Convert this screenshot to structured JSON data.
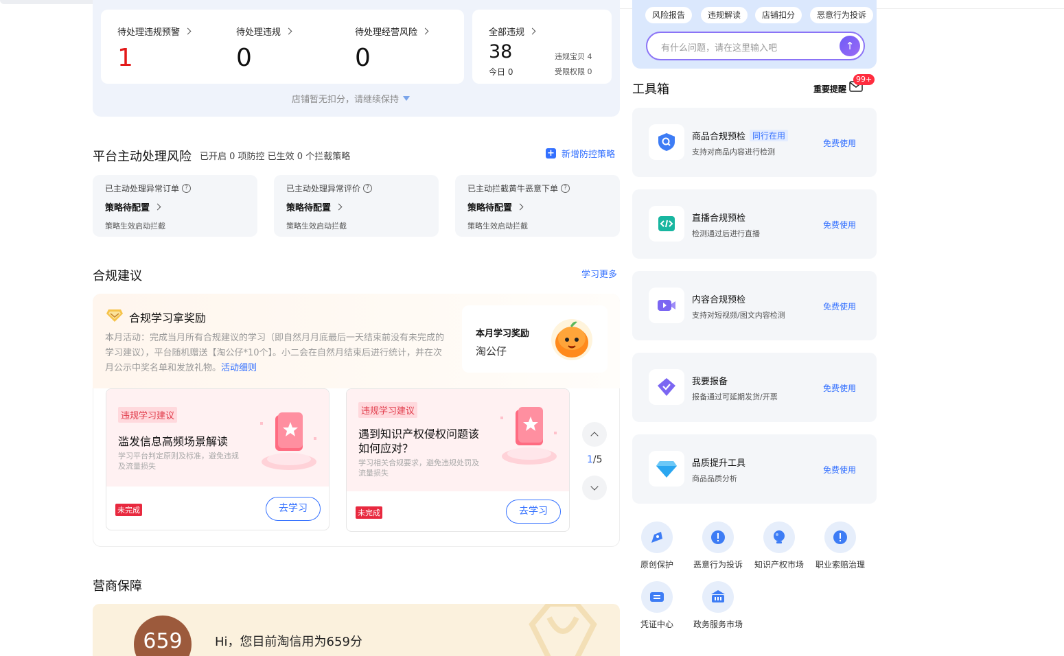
{
  "violations": {
    "items": [
      {
        "label": "待处理违规预警",
        "value": "1"
      },
      {
        "label": "待处理违规",
        "value": "0"
      },
      {
        "label": "待处理经营风险",
        "value": "0"
      }
    ],
    "all": {
      "label": "全部违规",
      "value": "38",
      "today": "今日 0",
      "sub1": "违规宝贝 4",
      "sub2": "受限权限 0"
    },
    "no_deduct": "店铺暂无扣分，请继续保持"
  },
  "risk": {
    "title": "平台主动处理风险",
    "subtitle": "已开启 0 项防控 已生效 0 个拦截策略",
    "add_label": "新增防控策略",
    "cards": [
      {
        "title": "已主动处理异常订单",
        "main": "策略待配置",
        "sub": "策略生效启动拦截"
      },
      {
        "title": "已主动处理异常评价",
        "main": "策略待配置",
        "sub": "策略生效启动拦截"
      },
      {
        "title": "已主动拦截黄牛恶意下单",
        "main": "策略待配置",
        "sub": "策略生效启动拦截"
      }
    ]
  },
  "advice": {
    "title": "合规建议",
    "learn_more": "学习更多",
    "reward_title": "合规学习拿奖励",
    "reward_desc": "本月活动：完成当月所有合规建议的学习（即自然月月底最后一天结束前没有未完成的学习建议），平台随机赠送【淘公仔*10个】。小二会在自然月结束后进行统计，并在次月公示中奖名单和发放礼物。",
    "reward_link": "活动细则",
    "monthly_label": "本月学习奖励",
    "monthly_value": "淘公仔",
    "cards": [
      {
        "tag": "违规学习建议",
        "title": "滥发信息高频场景解读",
        "desc": "学习平台判定原则及标准，避免违规及流量损失",
        "status": "未完成",
        "button": "去学习"
      },
      {
        "tag": "违规学习建议",
        "title": "遇到知识产权侵权问题该如何应对？",
        "desc": "学习相关合规要求，避免违规处罚及流量损失",
        "status": "未完成",
        "button": "去学习"
      }
    ],
    "pager": {
      "current": "1",
      "total": "/5"
    }
  },
  "guarantee": {
    "title": "营商保障",
    "score": "659",
    "text": "Hi，您目前淘信用为659分"
  },
  "assistant": {
    "chips": [
      "风险报告",
      "违规解读",
      "店铺扣分",
      "恶意行为投诉"
    ],
    "placeholder": "有什么问题，请在这里输入吧"
  },
  "toolbox": {
    "title": "工具箱",
    "important": "重要提醒",
    "badge": "99+",
    "tools": [
      {
        "name": "商品合规预检",
        "tag": "同行在用",
        "desc": "支持对商品内容进行检测",
        "action": "免费使用",
        "icon": "shield-search-icon",
        "color": "#3d7cf5"
      },
      {
        "name": "直播合规预检",
        "tag": "",
        "desc": "检测通过后进行直播",
        "action": "免费使用",
        "icon": "code-icon",
        "color": "#18b6a0"
      },
      {
        "name": "内容合规预检",
        "tag": "",
        "desc": "支持对短视频/图文内容检测",
        "action": "免费使用",
        "icon": "video-icon",
        "color": "#7b66f2"
      },
      {
        "name": "我要报备",
        "tag": "",
        "desc": "报备通过可延期发货/开票",
        "action": "免费使用",
        "icon": "check-badge-icon",
        "color": "#7b66f2"
      },
      {
        "name": "品质提升工具",
        "tag": "",
        "desc": "商品品质分析",
        "action": "免费使用",
        "icon": "diamond-icon",
        "color": "#2aa6f0"
      }
    ],
    "quick": [
      {
        "label": "原创保护",
        "icon": "original-protect-icon"
      },
      {
        "label": "恶意行为投诉",
        "icon": "complaint-icon"
      },
      {
        "label": "知识产权市场",
        "icon": "ip-market-icon"
      },
      {
        "label": "职业索赔治理",
        "icon": "claim-icon"
      },
      {
        "label": "凭证中心",
        "icon": "voucher-icon"
      },
      {
        "label": "政务服务市场",
        "icon": "gov-service-icon"
      }
    ]
  }
}
